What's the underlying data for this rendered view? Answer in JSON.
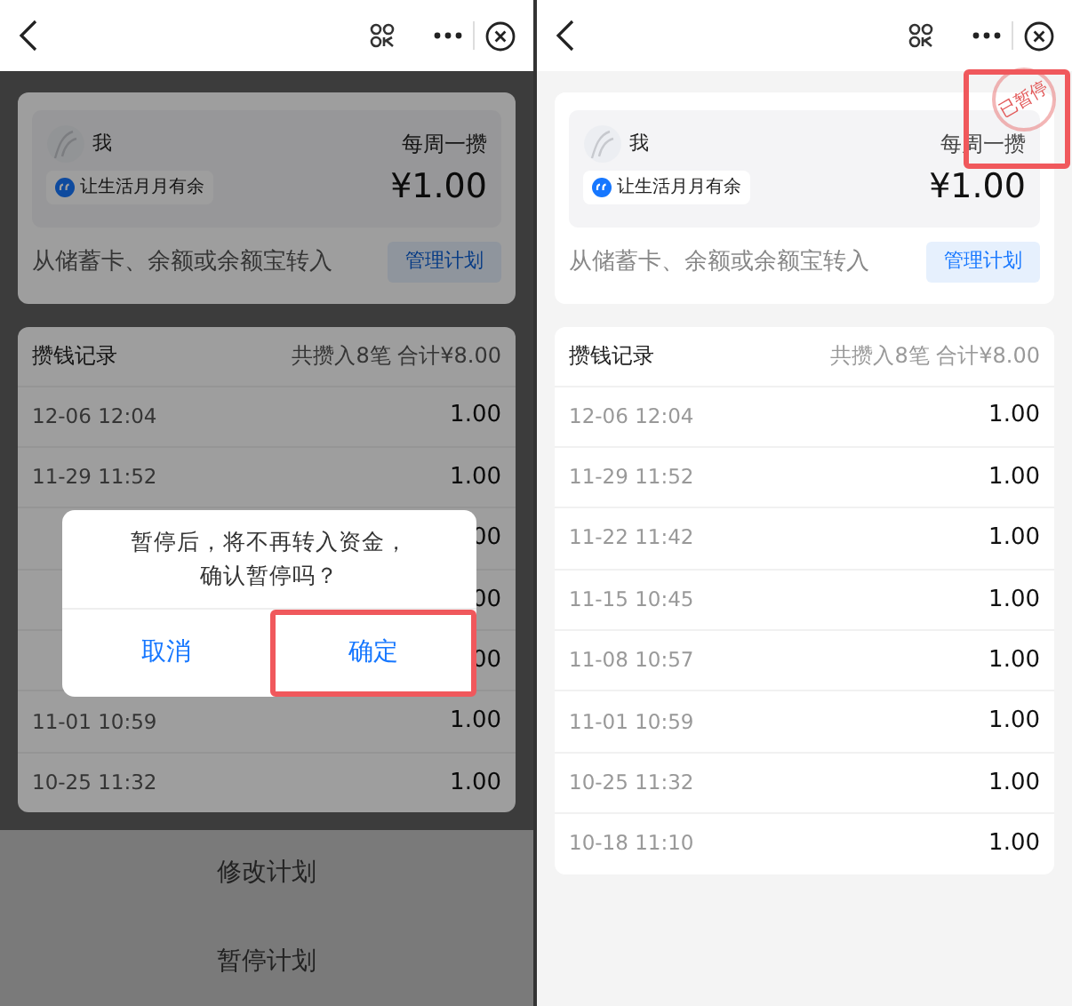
{
  "screens": [
    {
      "plan": {
        "owner": "我",
        "frequency": "每周一攒",
        "motto": "让生活月月有余",
        "amount": "¥1.00",
        "source": "从储蓄卡、余额或余额宝转入",
        "manage_button": "管理计划"
      },
      "records": {
        "title": "攒钱记录",
        "summary": "共攒入8笔 合计¥8.00",
        "rows": [
          {
            "date": "12-06 12:04",
            "amount": "1.00"
          },
          {
            "date": "11-29 11:52",
            "amount": "1.00"
          },
          {
            "amount": "00"
          },
          {
            "amount": "00"
          },
          {
            "amount": "00"
          },
          {
            "date": "11-01 10:59",
            "amount": "1.00"
          },
          {
            "date": "10-25 11:32",
            "amount": "1.00"
          }
        ]
      },
      "dialog": {
        "message_lines": [
          "暂停后，将不再转入资金，",
          "确认暂停吗？"
        ],
        "buttons": [
          {
            "label": "取消",
            "highlighted": false
          },
          {
            "label": "确定",
            "highlighted": true
          }
        ]
      },
      "action_sheet": [
        "修改计划",
        "暂停计划"
      ]
    },
    {
      "plan": {
        "owner": "我",
        "frequency": "每周一攒",
        "motto": "让生活月月有余",
        "amount": "¥1.00",
        "source": "从储蓄卡、余额或余额宝转入",
        "manage_button": "管理计划",
        "paused_stamp": {
          "label": "已暂停",
          "highlighted": true
        }
      },
      "records": {
        "title": "攒钱记录",
        "summary": "共攒入8笔 合计¥8.00",
        "rows": [
          {
            "date": "12-06 12:04",
            "amount": "1.00"
          },
          {
            "date": "11-29 11:52",
            "amount": "1.00"
          },
          {
            "date": "11-22 11:42",
            "amount": "1.00"
          },
          {
            "date": "11-15 10:45",
            "amount": "1.00"
          },
          {
            "date": "11-08 10:57",
            "amount": "1.00"
          },
          {
            "date": "11-01 10:59",
            "amount": "1.00"
          },
          {
            "date": "10-25 11:32",
            "amount": "1.00"
          },
          {
            "date": "10-18 11:10",
            "amount": "1.00"
          }
        ]
      }
    }
  ]
}
